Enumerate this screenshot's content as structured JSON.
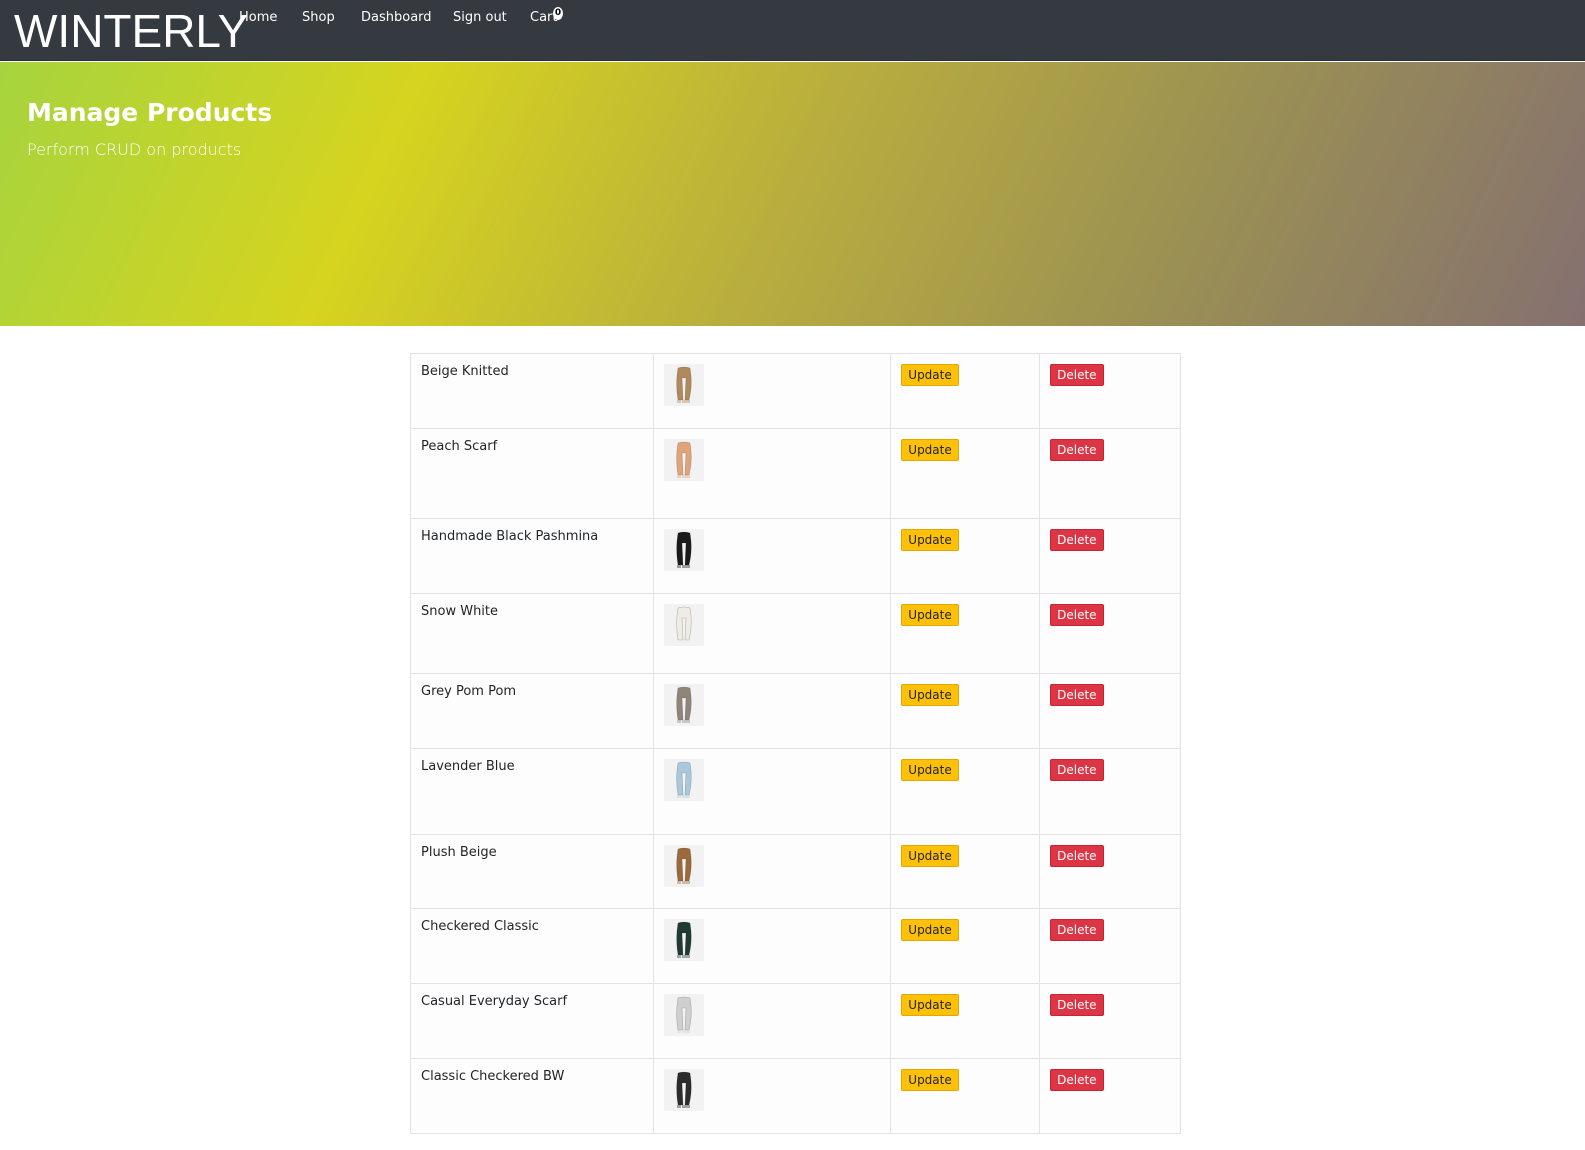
{
  "brand": "WINTERLY",
  "nav": {
    "home": "Home",
    "shop": "Shop",
    "dashboard": "Dashboard",
    "signout": "Sign out",
    "cart": "Cart",
    "cart_count": "0"
  },
  "hero": {
    "title": "Manage Products",
    "subtitle": "Perform CRUD on products"
  },
  "actions": {
    "update": "Update",
    "delete": "Delete"
  },
  "products": [
    {
      "name": "Beige Knitted",
      "icon": "beige-scarf-icon",
      "color": "#b08a5a"
    },
    {
      "name": "Peach Scarf",
      "icon": "peach-scarf-icon",
      "color": "#e0a37a"
    },
    {
      "name": "Handmade Black Pashmina",
      "icon": "black-scarf-icon",
      "color": "#1a1a1a"
    },
    {
      "name": "Snow White",
      "icon": "white-scarf-icon",
      "color": "#efece6"
    },
    {
      "name": "Grey Pom Pom",
      "icon": "grey-scarf-icon",
      "color": "#8f8579"
    },
    {
      "name": "Lavender Blue",
      "icon": "blue-scarf-icon",
      "color": "#a9c8dc"
    },
    {
      "name": "Plush Beige",
      "icon": "plush-scarf-icon",
      "color": "#9a6a3a"
    },
    {
      "name": "Checkered Classic",
      "icon": "checkered-scarf-icon",
      "color": "#1f3a33"
    },
    {
      "name": "Casual Everyday Scarf",
      "icon": "light-scarf-icon",
      "color": "#cfcfcf"
    },
    {
      "name": "Classic Checkered BW",
      "icon": "bw-scarf-icon",
      "color": "#2b2b2b"
    }
  ]
}
